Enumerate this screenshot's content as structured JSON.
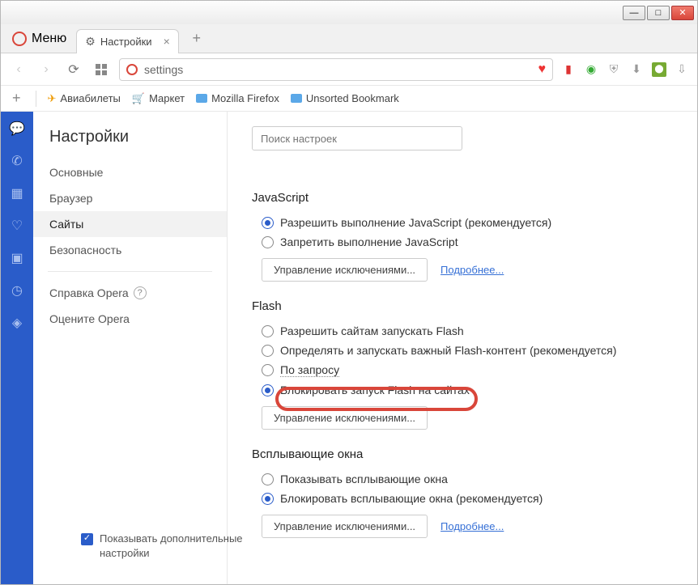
{
  "window": {
    "menu": "Меню"
  },
  "tab": {
    "title": "Настройки"
  },
  "address": {
    "text": "settings"
  },
  "bookmarks": {
    "aviabilet": "Авиабилеты",
    "market": "Маркет",
    "mozilla": "Mozilla Firefox",
    "unsorted": "Unsorted Bookmark"
  },
  "nav": {
    "title": "Настройки",
    "basic": "Основные",
    "browser": "Браузер",
    "sites": "Сайты",
    "security": "Безопасность",
    "help": "Справка Opera",
    "rate": "Оцените Opera",
    "advanced": "Показывать дополнительные настройки"
  },
  "content": {
    "search_placeholder": "Поиск настроек",
    "js": {
      "heading": "JavaScript",
      "allow": "Разрешить выполнение JavaScript (рекомендуется)",
      "deny": "Запретить выполнение JavaScript",
      "mgmt": "Управление исключениями...",
      "more": "Подробнее..."
    },
    "flash": {
      "heading": "Flash",
      "allow": "Разрешить сайтам запускать Flash",
      "detect": "Определять и запускать важный Flash-контент (рекомендуется)",
      "ondemand": "По запросу",
      "block": "Блокировать запуск Flash на сайтах",
      "mgmt": "Управление исключениями..."
    },
    "popup": {
      "heading": "Всплывающие окна",
      "show": "Показывать всплывающие окна",
      "block": "Блокировать всплывающие окна (рекомендуется)",
      "mgmt": "Управление исключениями...",
      "more": "Подробнее..."
    }
  }
}
